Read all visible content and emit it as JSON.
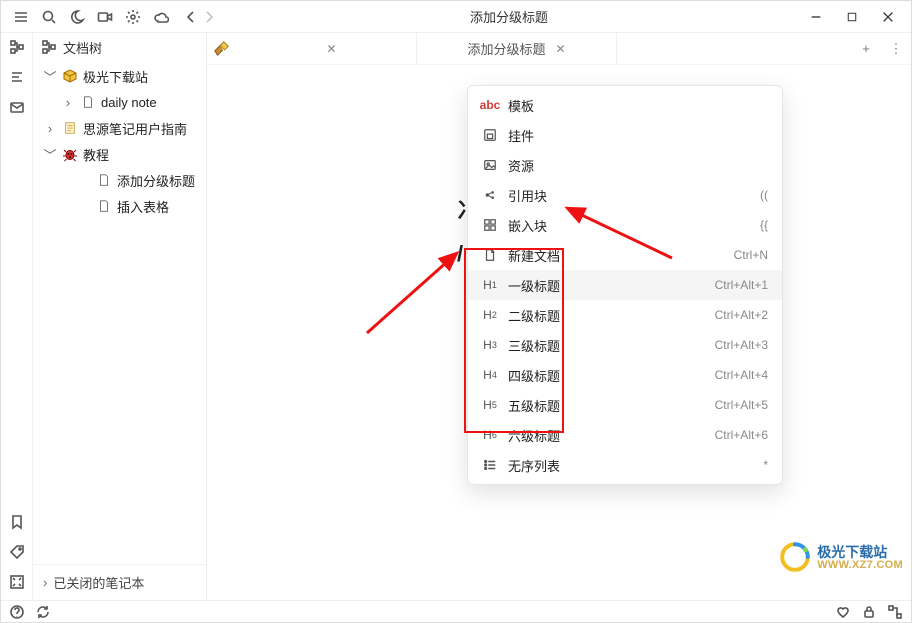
{
  "title": "添加分级标题",
  "sidebar": {
    "header": "文档树",
    "closed_label": "已关闭的笔记本",
    "tree": [
      {
        "label": "极光下载站",
        "icon": "box-yellow",
        "expanded": true,
        "depth": 1
      },
      {
        "label": "daily note",
        "icon": "doc",
        "expanded": false,
        "depth": 2,
        "hasCaret": true
      },
      {
        "label": "思源笔记用户指南",
        "icon": "page",
        "expanded": false,
        "depth": 1,
        "hasCaret": true
      },
      {
        "label": "教程",
        "icon": "bug",
        "expanded": true,
        "depth": 1,
        "hasCaret": true
      },
      {
        "label": "添加分级标题",
        "icon": "doc",
        "depth": 3
      },
      {
        "label": "插入表格",
        "icon": "doc",
        "depth": 3
      }
    ]
  },
  "tabs": {
    "items": [
      {
        "label": "",
        "kind": "context"
      },
      {
        "label": "添加分级标题",
        "closable": true
      }
    ],
    "plus": "+"
  },
  "slash_menu": {
    "items": [
      {
        "icon_text": "abc",
        "icon_class": "red",
        "label": "模板",
        "shortcut": "",
        "name": "menu-template"
      },
      {
        "icon": "widget",
        "label": "挂件",
        "shortcut": "",
        "name": "menu-widget"
      },
      {
        "icon": "image",
        "label": "资源",
        "shortcut": "",
        "name": "menu-asset"
      },
      {
        "icon": "ref",
        "label": "引用块",
        "shortcut": "((",
        "name": "menu-block-ref"
      },
      {
        "icon": "embed",
        "label": "嵌入块",
        "shortcut": "{{",
        "name": "menu-embed"
      },
      {
        "icon": "newdoc",
        "label": "新建文档",
        "shortcut": "Ctrl+N",
        "name": "menu-new-doc"
      },
      {
        "icon_text": "H",
        "sub": "1",
        "label": "一级标题",
        "shortcut": "Ctrl+Alt+1",
        "name": "menu-h1",
        "hover": true
      },
      {
        "icon_text": "H",
        "sub": "2",
        "label": "二级标题",
        "shortcut": "Ctrl+Alt+2",
        "name": "menu-h2"
      },
      {
        "icon_text": "H",
        "sub": "3",
        "label": "三级标题",
        "shortcut": "Ctrl+Alt+3",
        "name": "menu-h3"
      },
      {
        "icon_text": "H",
        "sub": "4",
        "label": "四级标题",
        "shortcut": "Ctrl+Alt+4",
        "name": "menu-h4"
      },
      {
        "icon_text": "H",
        "sub": "5",
        "label": "五级标题",
        "shortcut": "Ctrl+Alt+5",
        "name": "menu-h5"
      },
      {
        "icon_text": "H",
        "sub": "6",
        "label": "六级标题",
        "shortcut": "Ctrl+Alt+6",
        "name": "menu-h6"
      },
      {
        "icon": "list",
        "label": "无序列表",
        "shortcut": "*",
        "name": "menu-ul"
      }
    ]
  },
  "watermark": {
    "line1": "极光下载站",
    "line2": "WWW.XZ7.COM"
  }
}
